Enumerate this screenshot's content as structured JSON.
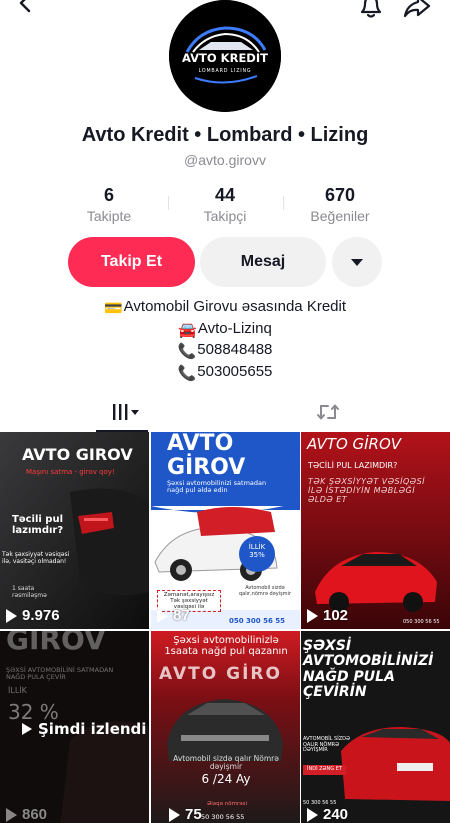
{
  "header": {
    "back_icon": "chevron-left-icon",
    "bell_icon": "bell-icon",
    "share_icon": "share-arrow-icon"
  },
  "profile": {
    "avatar_title": "AVTO KREDIT",
    "avatar_subtitle": "LOMBARD LIZING",
    "display_name": "Avto Kredit • Lombard • Lizing",
    "username": "@avto.girovv"
  },
  "stats": [
    {
      "value": "6",
      "label": "Takipte"
    },
    {
      "value": "44",
      "label": "Takipçi"
    },
    {
      "value": "670",
      "label": "Beğeniler"
    }
  ],
  "actions": {
    "follow_label": "Takip Et",
    "message_label": "Mesaj",
    "more_icon": "caret-down-icon"
  },
  "bio": [
    {
      "emoji": "💳",
      "text": "Avtomobil Girovu əsasında Kredit"
    },
    {
      "emoji": "🚘",
      "text": "Avto-Lizinq"
    },
    {
      "emoji": "📞",
      "text": "508848488"
    },
    {
      "emoji": "📞",
      "text": "503005655"
    }
  ],
  "tabs": {
    "videos_icon": "grid-videos-icon",
    "reposts_icon": "repost-icon"
  },
  "videos": [
    {
      "title": "AVTO GIROV",
      "subtitle": "Maşını satma - girov qoy!",
      "body": "Təcili pul lazımdır?",
      "note": "Tək şəxsiyyət vəsiqəsi ilə, vasitəçi olmadan!",
      "extra": "1 saata rəsmiləşmə",
      "views": "9.976"
    },
    {
      "title": "AVTO GİROV",
      "subtitle": "Şəxsi avtomobilinizi satmadan nağd pul əldə edin",
      "badge": "İLLİK 35%",
      "note": "Zəmanət,arayışsız Tək şəxsiyyət vəsiqəsi ilə",
      "extra": "Avtomobil sizdə qalır,nömrə dəyişmir",
      "phone": "050 300 56 55",
      "views": "87"
    },
    {
      "title": "AVTO GİROV",
      "subtitle": "TƏCİLİ PUL LAZIMDIR?",
      "body": "TƏK ŞƏXSİYYƏT VƏSİQƏSİ İLƏ İSTƏDİYİN MƏBLƏĞİ ƏLDƏ ET",
      "phone": "050 300 56 55",
      "views": "102"
    },
    {
      "title": "GIROV",
      "subtitle": "ŞƏXSİ AVTOMOBİLİNİ SATMADAN NAĞD PULA ÇEVİR",
      "rate_label": "İLLİK",
      "rate": "32 %",
      "overlay": "Şimdi izlendi",
      "views": "860"
    },
    {
      "title": "AVTO GİRO",
      "subtitle": "Şəxsi avtomobilinizlə 1saata nağd pul qazanın",
      "body": "Avtomobil sizdə qalır Nömrə dəyişmir",
      "term": "6 /24 Ay",
      "footer": "Əlaqə nömrəsi",
      "phone": "50 300 56 55",
      "views": "75"
    },
    {
      "title": "ŞƏXSİ AVTOMOBİLİNİZİ NAĞD PULA ÇEVİRİN",
      "body": "AVTOMOBİL SİZDƏ QALIR NÖMRƏ DƏYİŞMİR",
      "cta": "İNDİ ZƏNG ET",
      "phone": "50 300 56 55",
      "views": "240"
    }
  ],
  "colors": {
    "accent": "#fe2c55",
    "text_primary": "#161823",
    "text_secondary": "#8a8b91",
    "button_gray": "#f1f1f2"
  }
}
